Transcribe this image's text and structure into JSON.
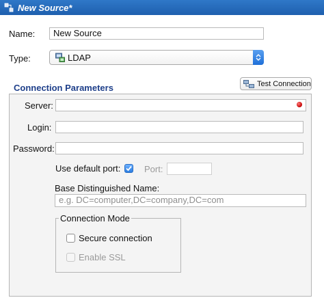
{
  "window": {
    "title": "New Source*",
    "title_icon": "source-icon"
  },
  "form": {
    "name_label": "Name:",
    "name_value": "New Source",
    "type_label": "Type:",
    "type_value": "LDAP",
    "type_icon": "ldap-icon"
  },
  "connection": {
    "section_title": "Connection Parameters",
    "test_button": "Test Connection",
    "server_label": "Server:",
    "server_value": "",
    "server_status_color": "#c30000",
    "login_label": "Login:",
    "login_value": "",
    "password_label": "Password:",
    "password_value": "",
    "default_port_label": "Use default port:",
    "default_port_checked": true,
    "port_label": "Port:",
    "port_value": "",
    "base_dn_label": "Base Distinguished Name:",
    "base_dn_placeholder": "e.g. DC=computer,DC=company,DC=com"
  },
  "connection_mode": {
    "title": "Connection Mode",
    "secure_label": "Secure connection",
    "secure_checked": false,
    "ssl_label": "Enable SSL",
    "ssl_checked": false
  },
  "colors": {
    "titlebar": "#2570c0",
    "section_title": "#1e3f8a",
    "checkbox_on": "#2a7de1"
  }
}
